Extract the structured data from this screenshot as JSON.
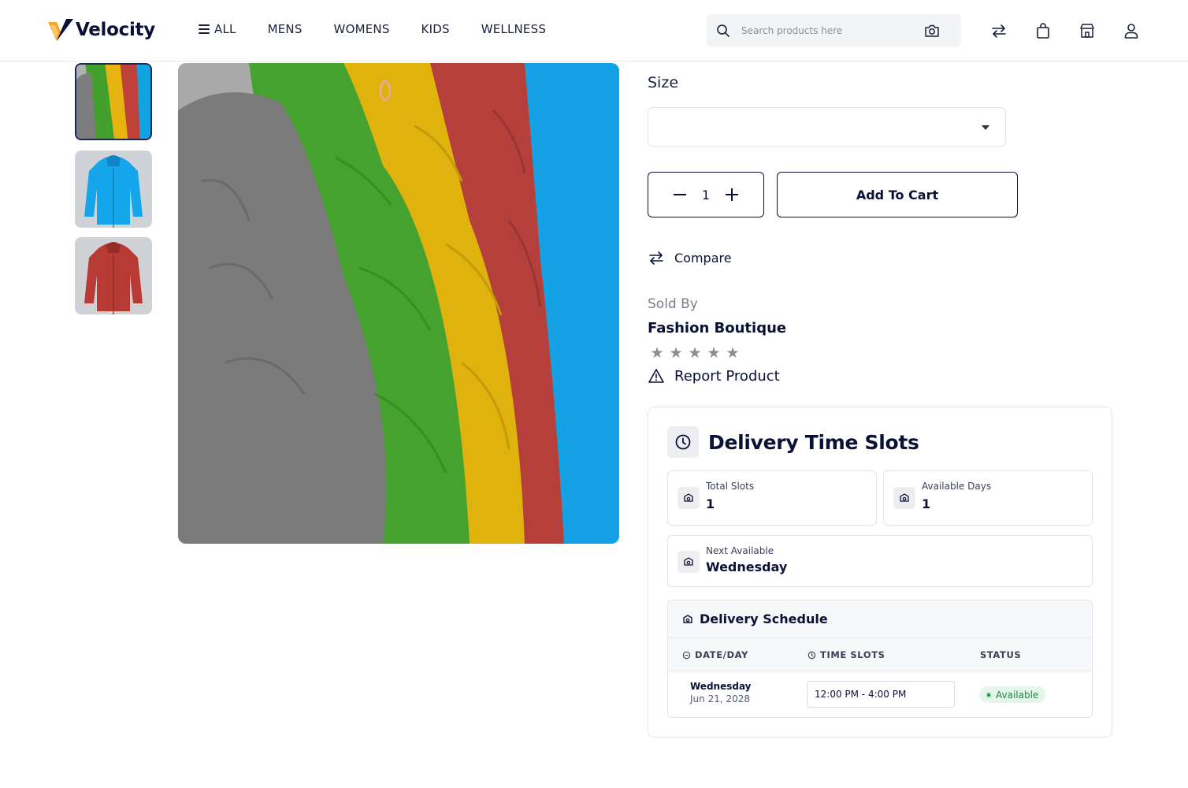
{
  "brand": {
    "name": "Velocity",
    "accent": "#f5a623",
    "primary": "#0b1136"
  },
  "nav": {
    "items": [
      {
        "label": "ALL",
        "icon": "menu-icon"
      },
      {
        "label": "MENS"
      },
      {
        "label": "WOMENS"
      },
      {
        "label": "KIDS"
      },
      {
        "label": "WELLNESS"
      }
    ]
  },
  "search": {
    "placeholder": "Search products here",
    "icon": "search-icon",
    "camera_icon": "camera-icon"
  },
  "header_icons": [
    "compare-icon",
    "shopping-bag-icon",
    "store-icon",
    "user-icon"
  ],
  "gallery": {
    "thumbnails": [
      "multicolor-jackets",
      "blue-jacket",
      "red-jacket"
    ],
    "active_index": 0
  },
  "product": {
    "size_label": "Size",
    "size_value": "",
    "quantity": "1",
    "add_to_cart": "Add To Cart",
    "compare": "Compare",
    "sold_by_label": "Sold By",
    "seller": "Fashion Boutique",
    "rating": 0,
    "rating_max": 5,
    "report": "Report Product"
  },
  "delivery": {
    "title": "Delivery Time Slots",
    "total_slots_label": "Total Slots",
    "total_slots": "1",
    "available_days_label": "Available Days",
    "available_days": "1",
    "next_available_label": "Next Available",
    "next_available": "Wednesday",
    "schedule_title": "Delivery Schedule",
    "columns": [
      "DATE/DAY",
      "TIME SLOTS",
      "STATUS"
    ],
    "rows": [
      {
        "day": "Wednesday",
        "date": "Jun 21, 2028",
        "slot": "12:00 PM - 4:00 PM",
        "status": "Available"
      }
    ]
  }
}
